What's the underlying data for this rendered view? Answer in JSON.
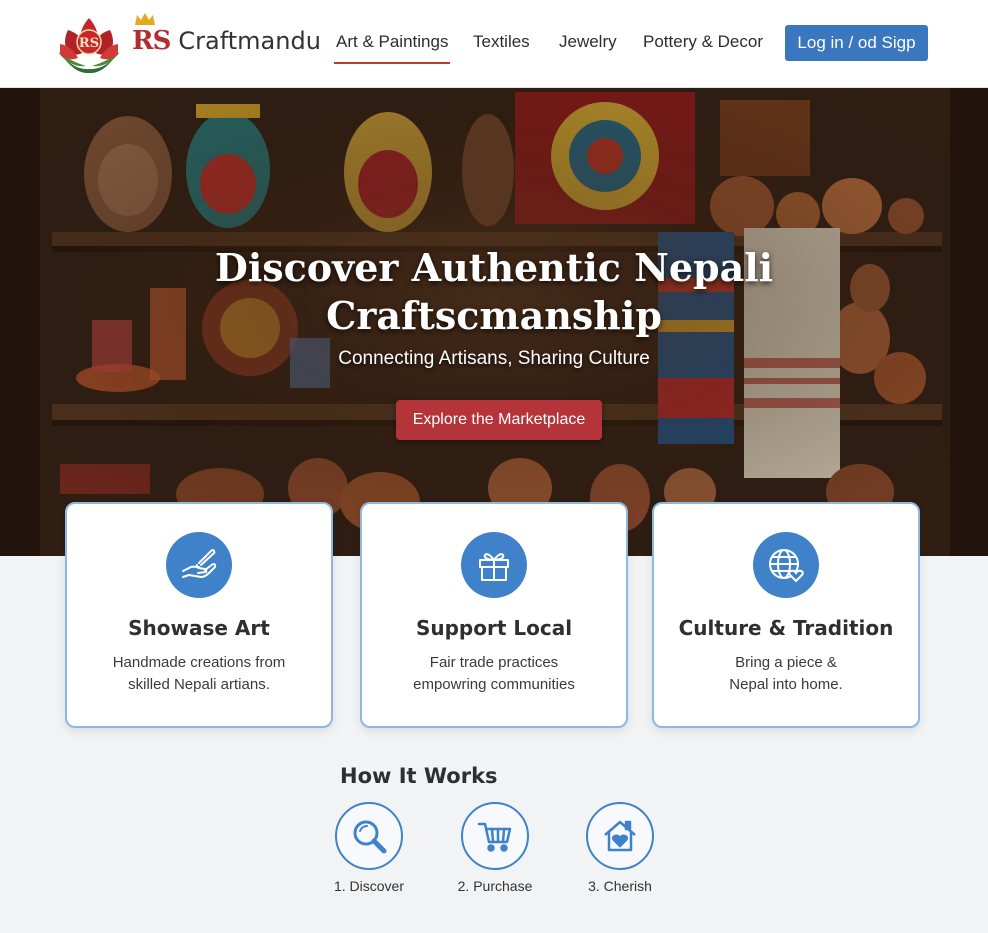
{
  "brand": {
    "initials": "RS",
    "name": "Craftmandu",
    "logo_badge": "RS"
  },
  "nav": {
    "items": [
      {
        "label": "Art & Paintings",
        "active": true
      },
      {
        "label": "Textiles",
        "active": false
      },
      {
        "label": "Jewelry",
        "active": false
      },
      {
        "label": "Pottery & Decor",
        "active": false
      }
    ],
    "login_label": "Log in / od Sigp"
  },
  "hero": {
    "title_line1": "Discover Authentic Nepali",
    "title_line2": "Craftscmanship",
    "subtitle": "Connecting Artisans, Sharing Culture",
    "cta_label": "Explore the Marketplace"
  },
  "features": [
    {
      "icon": "hand-brush-icon",
      "title": "Showase Art",
      "text_line1": "Handmade creations from",
      "text_line2": "skilled Nepali artians."
    },
    {
      "icon": "gift-icon",
      "title": "Support Local",
      "text_line1": "Fair trade practices",
      "text_line2": "empowring communities"
    },
    {
      "icon": "globe-heart-icon",
      "title": "Culture & Tradition",
      "text_line1": "Bring a piece &",
      "text_line2": "Nepal into home."
    }
  ],
  "how_it_works": {
    "title": "How It Works",
    "steps": [
      {
        "icon": "search-icon",
        "label": "1. Discover"
      },
      {
        "icon": "cart-icon",
        "label": "2. Purchase"
      },
      {
        "icon": "home-heart-icon",
        "label": "3. Cherish"
      }
    ]
  },
  "colors": {
    "primary_blue": "#3a77be",
    "accent_red": "#b5343a",
    "nav_underline": "#c0392b",
    "card_border": "#8cb8e2",
    "page_bg": "#f2f3f5"
  }
}
